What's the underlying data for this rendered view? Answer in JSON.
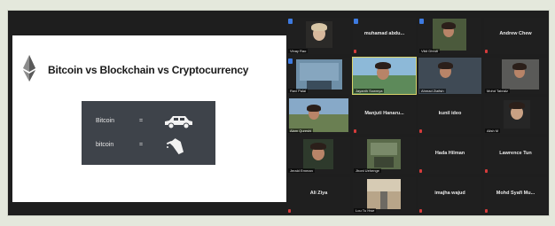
{
  "slide": {
    "title": "Bitcoin vs Blockchain vs Cryptocurrency",
    "rows": [
      {
        "term": "Bitcoin",
        "eq": "=",
        "icon": "car-icon"
      },
      {
        "term": "bitcoin",
        "eq": "=",
        "icon": "fuel-nozzle-icon"
      }
    ]
  },
  "participants": [
    {
      "name": "",
      "label": "Vinay Rao"
    },
    {
      "name": "muhamad abdu...",
      "label": ""
    },
    {
      "name": "",
      "label": "Vikli Dhruti"
    },
    {
      "name": "Andrew Chew",
      "label": ""
    },
    {
      "name": "",
      "label": "Ravi Palai"
    },
    {
      "name": "",
      "label": "Jayanth Sowmya"
    },
    {
      "name": "",
      "label": "Ahmad Ziafish"
    },
    {
      "name": "",
      "label": "Mohd Tabraiz"
    },
    {
      "name": "",
      "label": "Alam Qureshi"
    },
    {
      "name": "Manjuti Hanaru...",
      "label": ""
    },
    {
      "name": "kunil ideo",
      "label": ""
    },
    {
      "name": "",
      "label": "Alish M"
    },
    {
      "name": "",
      "label": "Jerald Emman"
    },
    {
      "name": "",
      "label": "Jhoni Uehenge"
    },
    {
      "name": "Hada Hilman",
      "label": ""
    },
    {
      "name": "Lawrence Tun",
      "label": ""
    },
    {
      "name": "Ali Ziya",
      "label": ""
    },
    {
      "name": "",
      "label": "Lou Tu Hwe"
    },
    {
      "name": "imajha wajud",
      "label": ""
    },
    {
      "name": "Mohd Syafi Mu...",
      "label": ""
    }
  ]
}
